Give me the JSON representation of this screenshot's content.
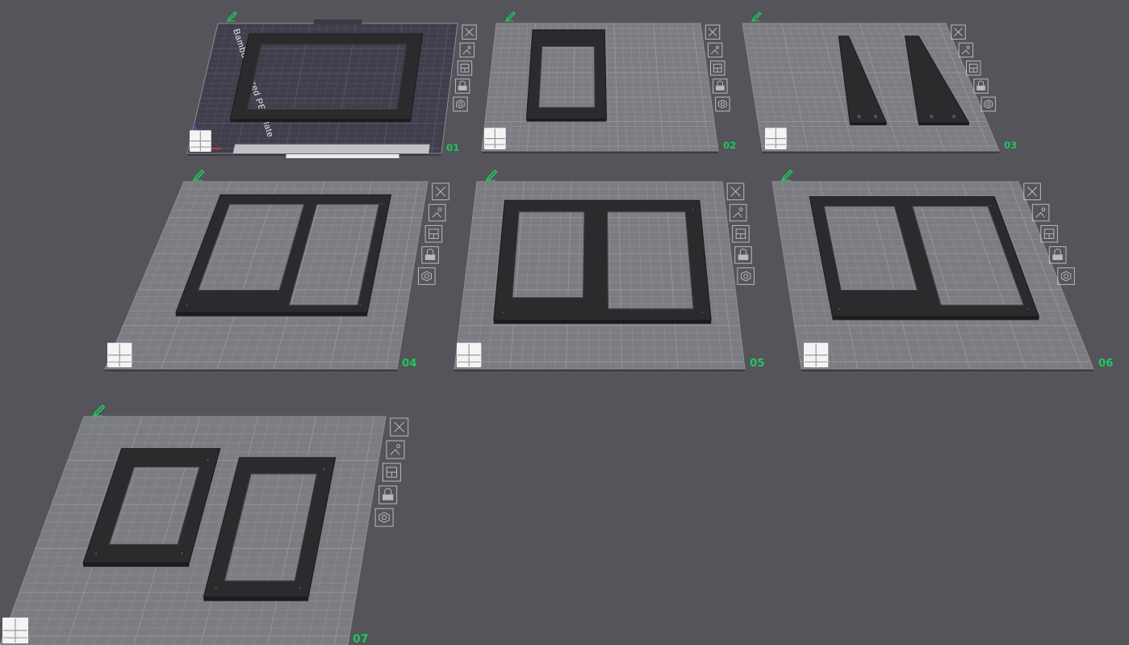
{
  "colors": {
    "background": "#54545a",
    "plate_fill": "#7c7c83",
    "plate_grid": "#9a9aa1",
    "plate_edge": "#8e8e95",
    "active_plate_fill": "#3f3f4c",
    "active_plate_grid": "#5b5b6b",
    "part_fill": "#2b2b2d",
    "part_edge": "#1a1a1b",
    "accent_green": "#22c55e",
    "icon_stroke": "#b9b9be"
  },
  "plates": [
    {
      "number": "01",
      "title": "Bambu Textured PEI Plate",
      "active": true
    },
    {
      "number": "02",
      "active": false
    },
    {
      "number": "03",
      "active": false
    },
    {
      "number": "04",
      "active": false
    },
    {
      "number": "05",
      "active": false
    },
    {
      "number": "06",
      "active": false
    },
    {
      "number": "07",
      "active": false
    }
  ],
  "plate_tools": [
    "close-icon",
    "auto-orient-icon",
    "arrange-icon",
    "lock-icon",
    "settings-icon"
  ],
  "plate_corner_icon": "grid-icon",
  "plate_edit_icon": "pencil-icon"
}
